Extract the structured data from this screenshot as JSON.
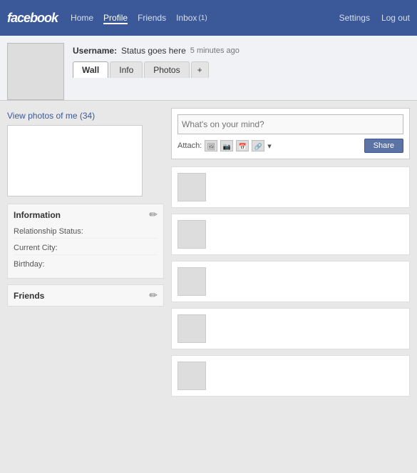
{
  "navbar": {
    "brand": "facebook",
    "links": [
      {
        "label": "Home",
        "active": false
      },
      {
        "label": "Profile",
        "active": true
      },
      {
        "label": "Friends",
        "active": false
      },
      {
        "label": "Inbox",
        "active": false
      }
    ],
    "inbox_badge": "(1)",
    "right_links": [
      {
        "label": "Settings"
      },
      {
        "label": "Log out"
      }
    ]
  },
  "profile": {
    "status_label": "Username:",
    "status_text": "Status goes here",
    "status_time": "5 minutes ago",
    "tabs": [
      {
        "label": "Wall",
        "active": true
      },
      {
        "label": "Info",
        "active": false
      },
      {
        "label": "Photos",
        "active": false
      },
      {
        "label": "+",
        "active": false
      }
    ]
  },
  "status_box": {
    "placeholder": "What's on your mind?",
    "attach_label": "Attach:",
    "share_label": "Share"
  },
  "left": {
    "view_photos": "View photos of me (34)",
    "information_title": "Information",
    "fields": [
      {
        "label": "Relationship Status:"
      },
      {
        "label": "Current City:"
      },
      {
        "label": "Birthday:"
      }
    ],
    "friends_title": "Friends"
  }
}
